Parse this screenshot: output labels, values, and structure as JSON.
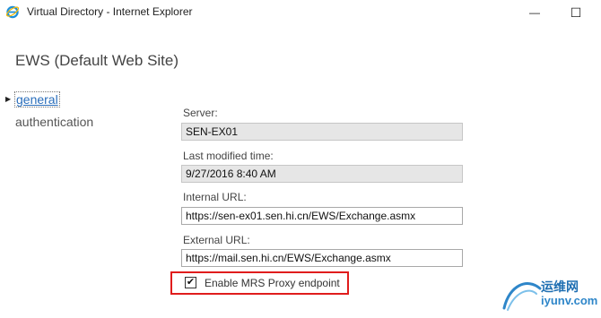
{
  "window": {
    "title": "Virtual Directory - Internet Explorer",
    "minimize_glyph": "—",
    "maximize_glyph": "☐"
  },
  "page": {
    "title": "EWS (Default Web Site)"
  },
  "nav": {
    "items": [
      {
        "label": "general",
        "selected": true
      },
      {
        "label": "authentication",
        "selected": false
      }
    ]
  },
  "form": {
    "server": {
      "label": "Server:",
      "value": "SEN-EX01"
    },
    "last_modified": {
      "label": "Last modified time:",
      "value": "9/27/2016 8:40 AM"
    },
    "internal_url": {
      "label": "Internal URL:",
      "value": "https://sen-ex01.sen.hi.cn/EWS/Exchange.asmx"
    },
    "external_url": {
      "label": "External URL:",
      "value": "https://mail.sen.hi.cn/EWS/Exchange.asmx"
    },
    "mrs_proxy": {
      "label": "Enable MRS Proxy endpoint",
      "checked": true,
      "check_glyph": "✔"
    }
  },
  "watermark": {
    "text1": "运维网",
    "text2": "iyunv.com"
  },
  "colors": {
    "highlight": "#e01c1c",
    "link": "#2a6ebb"
  }
}
